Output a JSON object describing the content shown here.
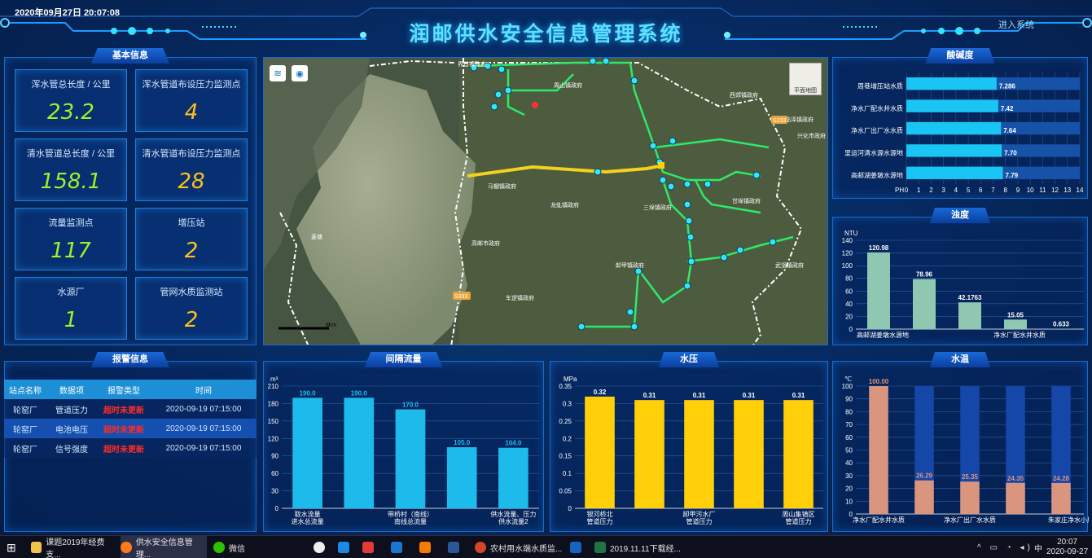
{
  "header": {
    "datetime": "2020年09月27日 20:07:08",
    "title": "润邮供水安全信息管理系统",
    "enter": "进入系统"
  },
  "basic": {
    "title": "基本信息",
    "cards": [
      {
        "label": "浑水管总长度 / 公里",
        "value": "23.2",
        "color": "#9df22b"
      },
      {
        "label": "浑水管道布设压力监测点",
        "value": "4",
        "color": "#ffc11c"
      },
      {
        "label": "清水管道总长度 / 公里",
        "value": "158.1",
        "color": "#9df22b"
      },
      {
        "label": "清水管道布设压力监测点",
        "value": "28",
        "color": "#ffc11c"
      },
      {
        "label": "流量监测点",
        "value": "117",
        "color": "#9df22b"
      },
      {
        "label": "增压站",
        "value": "2",
        "color": "#ffc11c"
      },
      {
        "label": "水源厂",
        "value": "1",
        "color": "#9df22b"
      },
      {
        "label": "管网水质监测站",
        "value": "2",
        "color": "#ffc11c"
      }
    ]
  },
  "alarm": {
    "title": "报警信息",
    "columns": [
      "站点名称",
      "数据项",
      "报警类型",
      "时间"
    ],
    "rows": [
      [
        "轮窑厂",
        "管道压力",
        "超时未更新",
        "2020-09-19 07:15:00"
      ],
      [
        "轮窑厂",
        "电池电压",
        "超时未更新",
        "2020-09-19 07:15:00"
      ],
      [
        "轮窑厂",
        "信号强度",
        "超时未更新",
        "2020-09-19 07:15:00"
      ]
    ]
  },
  "map": {
    "labels": [
      "界首镇政府",
      "周山镇政府",
      "西郊镇政府",
      "临泽镇政府",
      "兴化市政府",
      "马棚镇政府",
      "龙虬镇政府",
      "三垛镇政府",
      "甘垛镇政府",
      "高邮市政府",
      "卸甲镇政府",
      "武坚镇政府",
      "车逻镇政府",
      "菱塘",
      "S233",
      "S233",
      "S333"
    ],
    "scale": "8km",
    "layer_btn": "平面地图"
  },
  "chart_data": [
    {
      "id": "ph",
      "type": "bar",
      "orientation": "horizontal",
      "title": "酸碱度",
      "categories": [
        "周巷增压站水质",
        "净水厂配水井水质",
        "净水厂出厂水水质",
        "里运河清水源水源地",
        "高邮湖姜墩水源地"
      ],
      "values": [
        7.286,
        7.42,
        7.64,
        7.7,
        7.79
      ],
      "labels": [
        "7.286",
        "7.42",
        "7.64",
        "7.70",
        "7.79"
      ],
      "xlabel": "PH",
      "xlim": [
        0,
        14
      ],
      "ticks": [
        "0",
        "1",
        "2",
        "3",
        "4",
        "5",
        "6",
        "7",
        "8",
        "9",
        "10",
        "11",
        "12",
        "13",
        "14"
      ],
      "color": "#19c6f3"
    },
    {
      "id": "turb",
      "type": "bar",
      "title": "浊度",
      "ylabel": "NTU",
      "ylim": [
        0,
        140
      ],
      "ticks": [
        "0",
        "20",
        "40",
        "60",
        "80",
        "100",
        "120",
        "140"
      ],
      "categories": [
        "高邮湖姜墩水源地",
        "净水厂配水井水质"
      ],
      "values": [
        120.98,
        78.96,
        42.1763,
        15.05,
        0.633
      ],
      "labels": [
        "120.98",
        "78.96",
        "42.1763",
        "15.05",
        "0.633"
      ],
      "color": "#8fc7b1"
    },
    {
      "id": "flow",
      "type": "bar",
      "title": "间隔流量",
      "ylabel": "m³",
      "ylim": [
        0,
        210
      ],
      "ticks": [
        "0",
        "30",
        "60",
        "90",
        "120",
        "150",
        "180",
        "210"
      ],
      "categories": [
        "取水流量\n进水总流量",
        "",
        "带桥村（南线）\n南线总流量",
        "",
        "供水流量、压力\n供水流量2"
      ],
      "values": [
        190.0,
        190.0,
        170.0,
        105.0,
        104.0
      ],
      "labels": [
        "190.0",
        "190.0",
        "170.0",
        "105.0",
        "104.0"
      ],
      "color": "#1cbbec"
    },
    {
      "id": "press",
      "type": "bar",
      "title": "水压",
      "ylabel": "MPa",
      "ylim": [
        0,
        0.35
      ],
      "ticks": [
        "0",
        "0.05",
        "0.1",
        "0.15",
        "0.2",
        "0.25",
        "0.3",
        "0.35"
      ],
      "categories": [
        "银河桥北\n管道压力",
        "",
        "卸甲污水厂\n管道压力",
        "",
        "周山集镇区\n管道压力"
      ],
      "values": [
        0.32,
        0.31,
        0.31,
        0.31,
        0.31
      ],
      "labels": [
        "0.32",
        "0.31",
        "0.31",
        "0.31",
        "0.31"
      ],
      "color": "#ffcf0a"
    },
    {
      "id": "temp",
      "type": "bar",
      "title": "水温",
      "ylabel": "℃",
      "ylim": [
        0,
        100
      ],
      "ticks": [
        "0",
        "10",
        "20",
        "30",
        "40",
        "50",
        "60",
        "70",
        "80",
        "90",
        "100"
      ],
      "categories": [
        "净水厂配水井水质",
        "净水厂出厂水水质",
        "朱家庄净水小屋"
      ],
      "values": [
        100.0,
        26.29,
        25.35,
        24.35,
        24.28
      ],
      "labels": [
        "100.00",
        "26.29",
        "25.35",
        "24.35",
        "24.28"
      ],
      "color": "#d9957e",
      "track": "#1447a8"
    }
  ],
  "taskbar": {
    "items": [
      "课题2019年经费支...",
      "供水安全信息管理...",
      "微信",
      "农村用水端水质监...",
      "2019.11.11下载经..."
    ],
    "time": "20:07",
    "date": "2020-09-27",
    "ime": "中"
  }
}
